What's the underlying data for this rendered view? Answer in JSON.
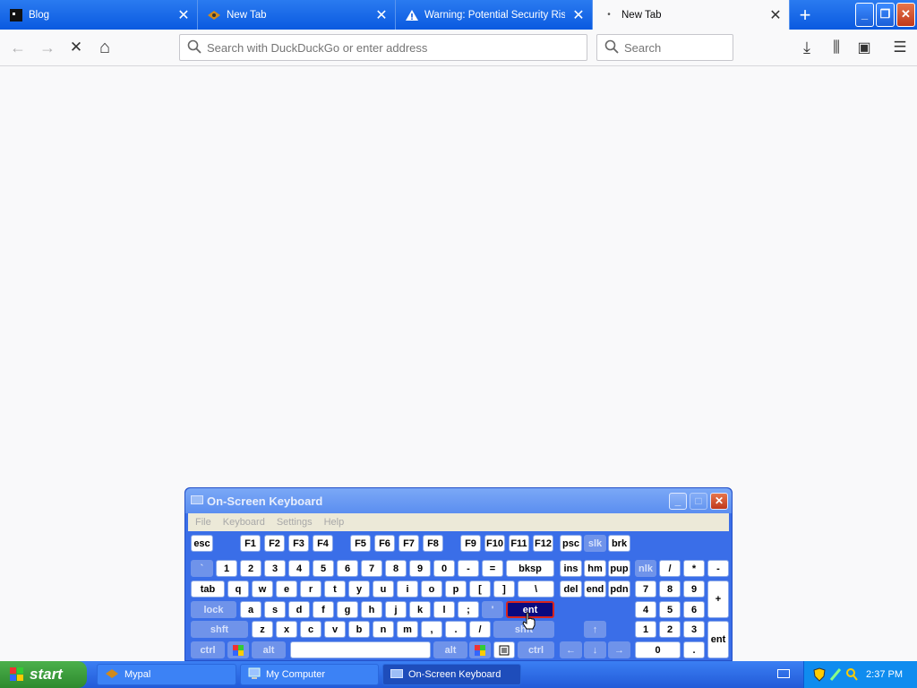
{
  "tabs": [
    {
      "title": "Blog",
      "close": "✕"
    },
    {
      "title": "New Tab",
      "close": "✕"
    },
    {
      "title": "Warning: Potential Security Risk Ahead",
      "close": "✕"
    },
    {
      "title": "New Tab",
      "close": "✕",
      "active": true
    }
  ],
  "newtab_glyph": "+",
  "window_buttons": {
    "minimize": "_",
    "restore": "❐",
    "close": "✕"
  },
  "nav": {
    "back": "←",
    "forward": "→",
    "stop": "✕",
    "home": "⌂"
  },
  "urlbar": {
    "placeholder": "Search with DuckDuckGo or enter address"
  },
  "searchbar": {
    "placeholder": "Search"
  },
  "toolbar": {
    "download": "⤓",
    "library": "⫼",
    "sidebar": "▣",
    "menu": "☰"
  },
  "osk": {
    "title": "On-Screen Keyboard",
    "menu": [
      "File",
      "Keyboard",
      "Settings",
      "Help"
    ],
    "win": {
      "minimize": "_",
      "maximize": "□",
      "close": "✕"
    },
    "keys": {
      "esc": "esc",
      "f1": "F1",
      "f2": "F2",
      "f3": "F3",
      "f4": "F4",
      "f5": "F5",
      "f6": "F6",
      "f7": "F7",
      "f8": "F8",
      "f9": "F9",
      "f10": "F10",
      "f11": "F11",
      "f12": "F12",
      "psc": "psc",
      "slk": "slk",
      "brk": "brk",
      "grave": "`",
      "n1": "1",
      "n2": "2",
      "n3": "3",
      "n4": "4",
      "n5": "5",
      "n6": "6",
      "n7": "7",
      "n8": "8",
      "n9": "9",
      "n0": "0",
      "minus": "-",
      "equal": "=",
      "bksp": "bksp",
      "ins": "ins",
      "hm": "hm",
      "pup": "pup",
      "nlk": "nlk",
      "kslash": "/",
      "kstar": "*",
      "kminus": "-",
      "tab": "tab",
      "q": "q",
      "w": "w",
      "e": "e",
      "r": "r",
      "t": "t",
      "y": "y",
      "u": "u",
      "i": "i",
      "o": "o",
      "p": "p",
      "lbr": "[",
      "rbr": "]",
      "bslash": "\\",
      "del": "del",
      "end": "end",
      "pdn": "pdn",
      "k7": "7",
      "k8": "8",
      "k9": "9",
      "kplus": "+",
      "lock": "lock",
      "a": "a",
      "s": "s",
      "d": "d",
      "f": "f",
      "g": "g",
      "h": "h",
      "j": "j",
      "k": "k",
      "l": "l",
      "semi": ";",
      "quote": "'",
      "ent": "ent",
      "k4": "4",
      "k5": "5",
      "k6": "6",
      "lshft": "shft",
      "z": "z",
      "x": "x",
      "c": "c",
      "v": "v",
      "b": "b",
      "n": "n",
      "m": "m",
      "comma": ",",
      "period": ".",
      "slash": "/",
      "rshft": "shft",
      "up": "↑",
      "k1": "1",
      "k2": "2",
      "k3": "3",
      "kent": "ent",
      "lctrl": "ctrl",
      "lalt": "alt",
      "ralt": "alt",
      "rctrl": "ctrl",
      "left": "←",
      "down": "↓",
      "right": "→",
      "k0": "0",
      "kdot": "."
    }
  },
  "taskbar": {
    "start": "start",
    "items": [
      "Mypal",
      "My Computer",
      "On-Screen Keyboard"
    ],
    "clock": "2:37 PM"
  }
}
